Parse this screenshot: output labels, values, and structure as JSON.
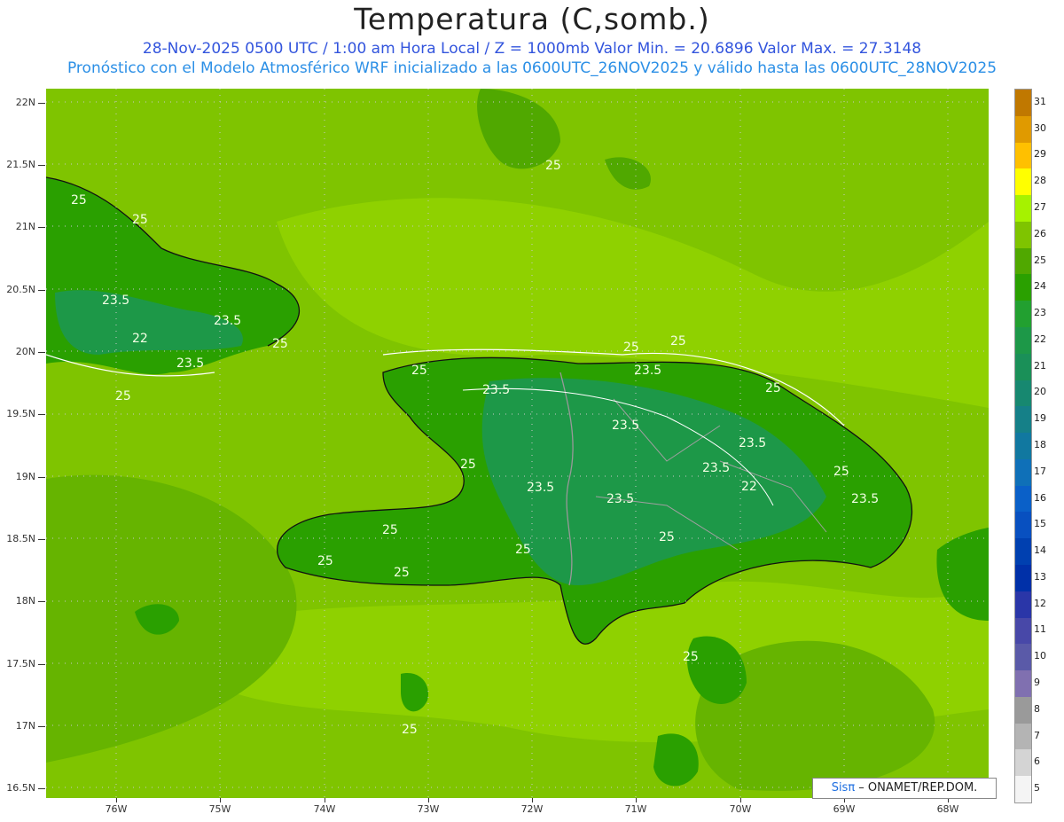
{
  "header": {
    "title": "Temperatura (C,somb.)",
    "line1": "28-Nov-2025  0500 UTC / 1:00 am Hora Local / Z = 1000mb   Valor Min. = 20.6896  Valor Max. = 27.3148",
    "line2": "Pronóstico con el Modelo Atmosférico WRF inicializado a las 0600UTC_26NOV2025 y válido hasta las  0600UTC_28NOV2025"
  },
  "axes": {
    "lat_labels": [
      "22N",
      "21.5N",
      "21N",
      "20.5N",
      "20N",
      "19.5N",
      "19N",
      "18.5N",
      "18N",
      "17.5N",
      "17N",
      "16.5N"
    ],
    "lon_labels": [
      "76W",
      "75W",
      "74W",
      "73W",
      "72W",
      "71W",
      "70W",
      "69W",
      "68W"
    ]
  },
  "contour_labels": [
    "25",
    "25",
    "25",
    "23.5",
    "23.5",
    "22",
    "23.5",
    "25",
    "25",
    "25",
    "23.5",
    "25",
    "23.5",
    "25",
    "25",
    "23.5",
    "23.5",
    "23.5",
    "22",
    "23.5",
    "25",
    "23.5",
    "25",
    "25",
    "25",
    "25",
    "25",
    "25",
    "23.5",
    "25",
    "25"
  ],
  "colorbar": {
    "labels": [
      "31",
      "30",
      "29",
      "28",
      "27",
      "26",
      "25",
      "24",
      "23",
      "22",
      "21",
      "20",
      "19",
      "18",
      "17",
      "16",
      "15",
      "14",
      "13",
      "12",
      "11",
      "10",
      "9",
      "8",
      "7",
      "6",
      "5"
    ],
    "colors": [
      "#c07800",
      "#e09a00",
      "#ffc000",
      "#ffff00",
      "#a6f200",
      "#7fc400",
      "#50a800",
      "#2aa000",
      "#22a030",
      "#1d9848",
      "#1a9058",
      "#178870",
      "#158088",
      "#1178a0",
      "#0f70b8",
      "#0a60c8",
      "#0850c0",
      "#0040b0",
      "#0030a8",
      "#2a36a8",
      "#4848a8",
      "#5a5aa8",
      "#8070b0",
      "#9a9a9a",
      "#b4b4b4",
      "#d4d4d4",
      "#f4f4f4"
    ]
  },
  "credit": {
    "brand": "Sisπ",
    "org": " – ONAMET/REP.DOM."
  },
  "colors": {
    "ocean": "#7fc400",
    "light": "#8fd100",
    "land_low": "#50a800",
    "land": "#2aa000",
    "land_high": "#1d9848"
  }
}
